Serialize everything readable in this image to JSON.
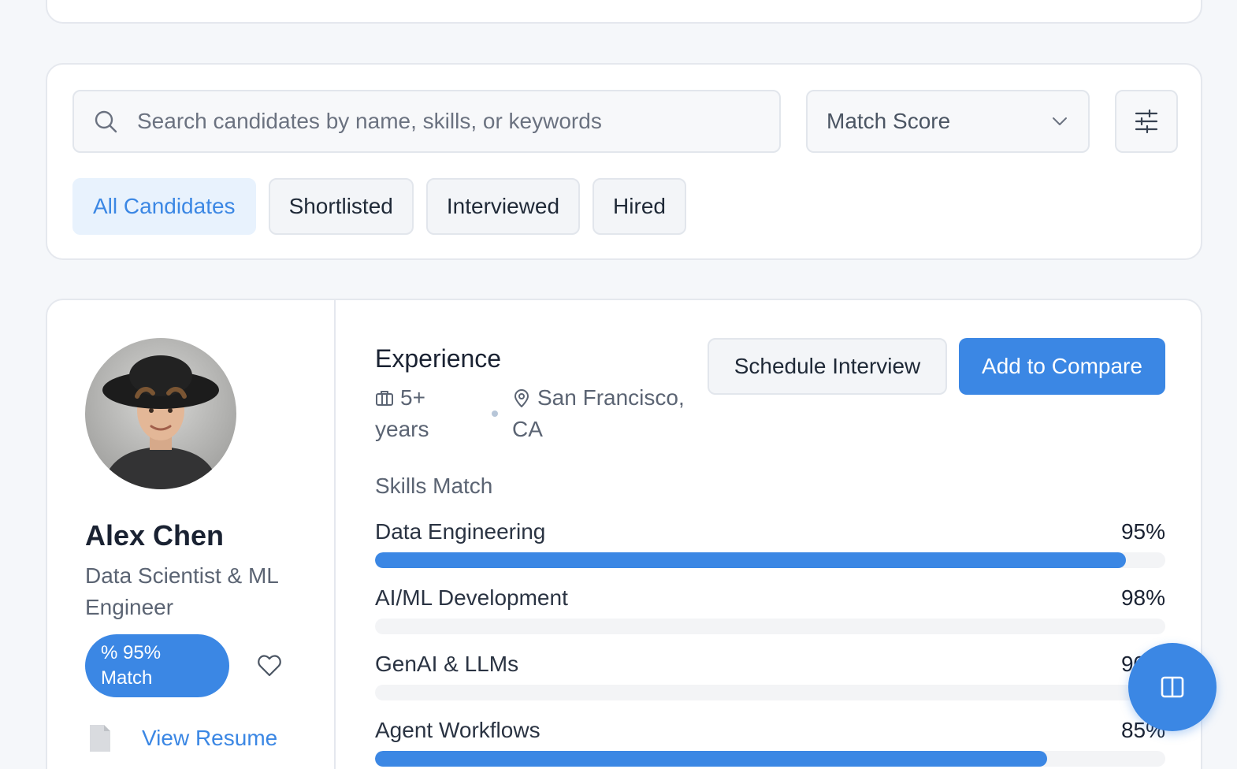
{
  "search": {
    "placeholder": "Search candidates by name, skills, or keywords",
    "value": ""
  },
  "sort": {
    "selected": "Match Score"
  },
  "tabs": [
    {
      "label": "All Candidates",
      "active": true
    },
    {
      "label": "Shortlisted",
      "active": false
    },
    {
      "label": "Interviewed",
      "active": false
    },
    {
      "label": "Hired",
      "active": false
    }
  ],
  "candidate": {
    "name": "Alex Chen",
    "title": "Data Scientist & ML Engineer",
    "match_badge": "% 95% Match",
    "resume_label": "View Resume",
    "experience_heading": "Experience",
    "years": "5+ years",
    "location": "San Francisco, CA",
    "actions": {
      "schedule_label": "Schedule Interview",
      "compare_label": "Add to Compare"
    },
    "skills_heading": "Skills Match",
    "skills": [
      {
        "label": "Data Engineering",
        "percent_label": "95%",
        "fill_percent": 95
      },
      {
        "label": "AI/ML Development",
        "percent_label": "98%",
        "fill_percent": 0
      },
      {
        "label": "GenAI & LLMs",
        "percent_label": "90%",
        "fill_percent": 0
      },
      {
        "label": "Agent Workflows",
        "percent_label": "85%",
        "fill_percent": 85
      }
    ]
  },
  "icons": {
    "search": "search-icon",
    "dropdown": "chevron-down-icon",
    "filter": "sliders-icon",
    "briefcase": "briefcase-icon",
    "location": "map-pin-icon",
    "favorite": "heart-icon",
    "document": "document-icon",
    "compare_fab": "columns-icon"
  },
  "colors": {
    "accent": "#3b87e4",
    "active_tab_bg": "#e8f2fd",
    "page_bg": "#f5f7fa"
  }
}
